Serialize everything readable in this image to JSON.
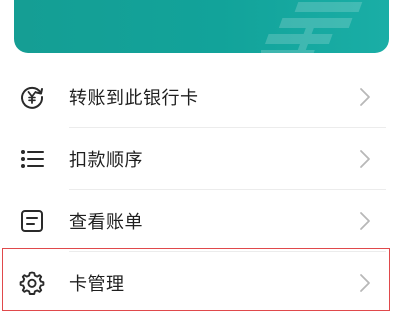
{
  "banner": {
    "color": "#13a198"
  },
  "menu": {
    "items": [
      {
        "label": "转账到此银行卡",
        "icon": "yuan-circular-arrow-icon"
      },
      {
        "label": "扣款顺序",
        "icon": "ordered-list-icon"
      },
      {
        "label": "查看账单",
        "icon": "bill-document-icon"
      },
      {
        "label": "卡管理",
        "icon": "gear-icon"
      }
    ]
  },
  "colors": {
    "highlight": "#e0494b",
    "text": "#1f1f1f",
    "icon": "#2a2a2a",
    "chevron": "#b8b8b8"
  }
}
